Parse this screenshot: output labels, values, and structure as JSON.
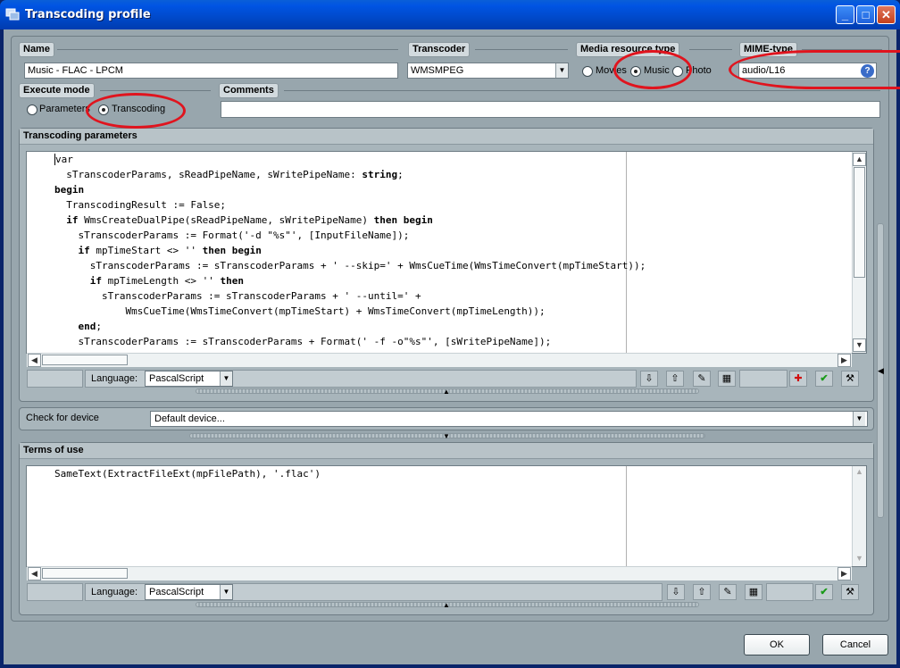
{
  "window": {
    "title": "Transcoding profile"
  },
  "name": {
    "label": "Name",
    "value": "Music - FLAC - LPCM"
  },
  "transcoder": {
    "label": "Transcoder",
    "value": "WMSMPEG"
  },
  "media_type": {
    "label": "Media resource type",
    "options": [
      "Movies",
      "Music",
      "Photo"
    ],
    "selected": "Music"
  },
  "mime": {
    "label": "MIME-type",
    "value": "audio/L16"
  },
  "execute_mode": {
    "label": "Execute mode",
    "options": [
      "Parameters",
      "Transcoding"
    ],
    "selected": "Transcoding"
  },
  "comments": {
    "label": "Comments",
    "value": ""
  },
  "transcoding": {
    "title": "Transcoding parameters",
    "language_label": "Language:",
    "language": "PascalScript"
  },
  "check_device": {
    "label": "Check for device",
    "value": "Default device..."
  },
  "terms": {
    "title": "Terms of use",
    "code": "SameText(ExtractFileExt(mpFilePath), '.flac')",
    "language_label": "Language:",
    "language": "PascalScript"
  },
  "buttons": {
    "ok": "OK",
    "cancel": "Cancel"
  },
  "icons": [
    "app-icon",
    "minimize-icon",
    "maximize-icon",
    "close-icon",
    "help-icon",
    "import-icon",
    "export-icon",
    "edit-icon",
    "calculator-icon",
    "lifebuoy-icon",
    "check-icon",
    "tools-icon"
  ]
}
